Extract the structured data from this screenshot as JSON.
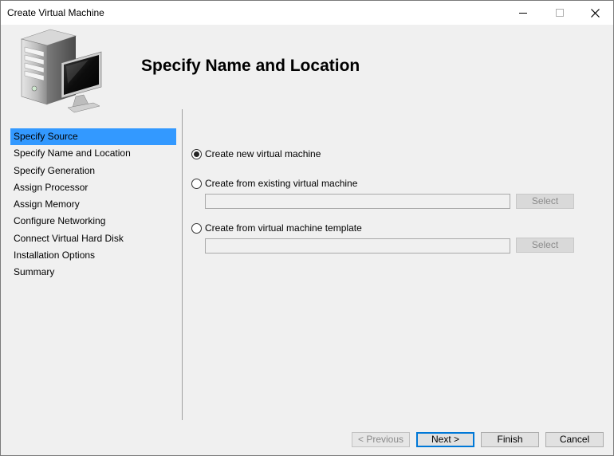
{
  "window": {
    "title": "Create Virtual Machine"
  },
  "header": {
    "title": "Specify Name and Location"
  },
  "nav": {
    "items": [
      {
        "label": "Specify Source"
      },
      {
        "label": "Specify Name and Location"
      },
      {
        "label": "Specify Generation"
      },
      {
        "label": "Assign Processor"
      },
      {
        "label": "Assign Memory"
      },
      {
        "label": "Configure Networking"
      },
      {
        "label": "Connect Virtual Hard Disk"
      },
      {
        "label": "Installation Options"
      },
      {
        "label": "Summary"
      }
    ],
    "active_index": 0
  },
  "options": {
    "new_vm": {
      "label": "Create new virtual machine",
      "checked": true
    },
    "existing_vm": {
      "label": "Create from existing virtual machine",
      "value": "",
      "select_label": "Select"
    },
    "template": {
      "label": "Create from virtual machine template",
      "value": "",
      "select_label": "Select"
    }
  },
  "footer": {
    "previous_label": "< Previous",
    "next_label": "Next >",
    "finish_label": "Finish",
    "cancel_label": "Cancel"
  },
  "colors": {
    "accent": "#3399ff",
    "default_button_border": "#0078d7"
  }
}
